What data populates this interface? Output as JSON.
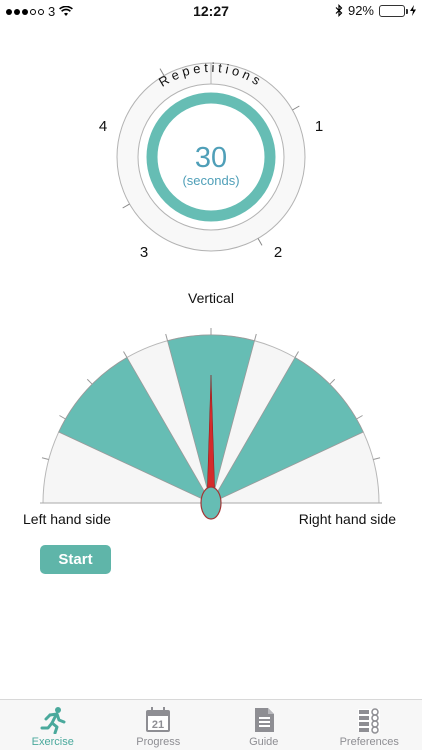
{
  "status_bar": {
    "carrier": "3",
    "time": "12:27",
    "battery_percent": "92%",
    "battery_level": 0.92
  },
  "repetitions": {
    "title": "Repetitions",
    "marks": [
      "1",
      "2",
      "3",
      "4"
    ],
    "timer_value": "30",
    "timer_unit": "(seconds)",
    "progress_color": "#66bdb4"
  },
  "gauge": {
    "top_label": "Vertical",
    "left_label": "Left hand side",
    "right_label": "Right hand side",
    "fill_color": "#66bdb4",
    "needle_color": "#d42b2b"
  },
  "actions": {
    "start_label": "Start"
  },
  "tabs": [
    {
      "label": "Exercise",
      "icon": "running-person-icon",
      "active": true
    },
    {
      "label": "Progress",
      "icon": "calendar-icon",
      "calendar_day": "21",
      "active": false
    },
    {
      "label": "Guide",
      "icon": "document-icon",
      "active": false
    },
    {
      "label": "Preferences",
      "icon": "checklist-icon",
      "active": false
    }
  ]
}
